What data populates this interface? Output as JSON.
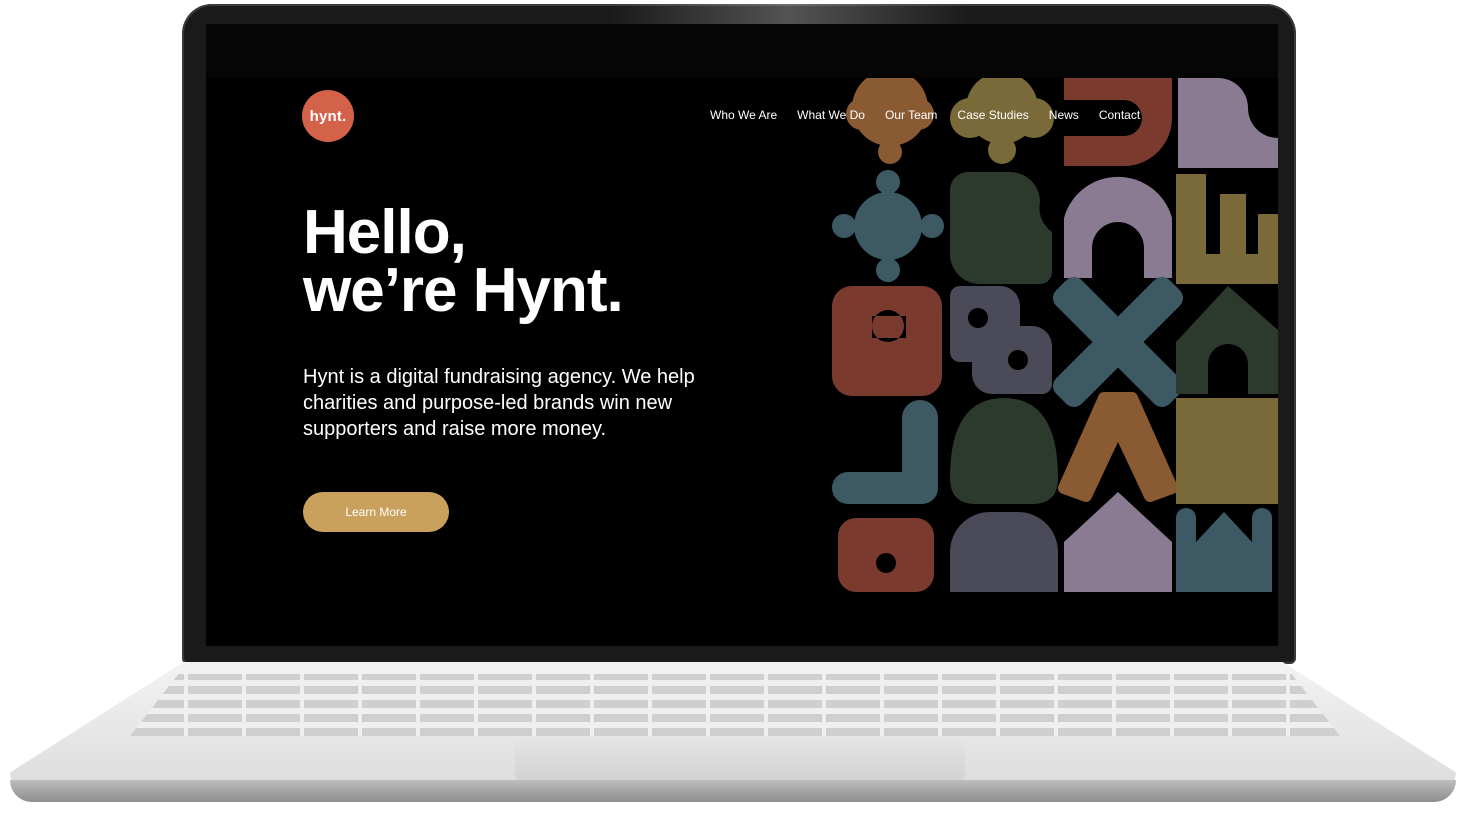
{
  "site": {
    "logo_text": "hynt.",
    "nav": [
      "Who We Are",
      "What We Do",
      "Our Team",
      "Case Studies",
      "News",
      "Contact"
    ],
    "hero": {
      "line1": "Hello,",
      "line2": "we’re Hynt.",
      "description": "Hynt is a digital fundraising agency. We help charities and purpose-led brands win new supporters and raise more money.",
      "cta_label": "Learn More"
    }
  },
  "colors": {
    "logo": "#d4624a",
    "cta": "#c9a05c",
    "shape_palette": [
      "#7a3b2e",
      "#8a5a33",
      "#7a6a3a",
      "#2c3a2e",
      "#3d5a64",
      "#8a7a92",
      "#4a4a58"
    ]
  }
}
